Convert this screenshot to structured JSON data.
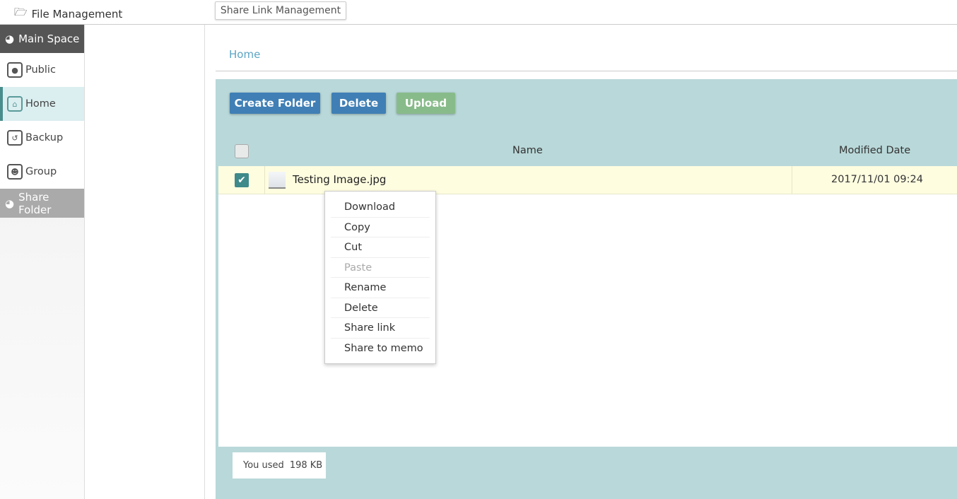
{
  "header": {
    "title": "File Management",
    "share_link_button": "Share Link Management"
  },
  "sidebar": {
    "main_space": "Main Space",
    "items": [
      {
        "label": "Public",
        "icon": "globe-icon"
      },
      {
        "label": "Home",
        "icon": "home-icon",
        "active": true
      },
      {
        "label": "Backup",
        "icon": "history-icon"
      },
      {
        "label": "Group",
        "icon": "group-icon"
      }
    ],
    "share_folder": "Share Folder"
  },
  "breadcrumb": {
    "home": "Home"
  },
  "toolbar": {
    "create_folder": "Create Folder",
    "delete": "Delete",
    "upload": "Upload"
  },
  "colors": {
    "primary_button": "#3f7fb5",
    "upload_button": "#88bb8a",
    "panel": "#b9d8d9",
    "selected_row": "#fefde0",
    "checkbox": "#3f8a8a"
  },
  "table": {
    "columns": [
      "Name",
      "Modified Date"
    ],
    "rows": [
      {
        "name": "Testing Image.jpg",
        "modified": "2017/11/01 09:24",
        "checked": true
      }
    ]
  },
  "context_menu": {
    "items": [
      {
        "label": "Download"
      },
      {
        "label": "Copy"
      },
      {
        "label": "Cut"
      },
      {
        "label": "Paste",
        "disabled": true
      },
      {
        "label": "Rename"
      },
      {
        "label": "Delete"
      },
      {
        "label": "Share link"
      },
      {
        "label": "Share to memo"
      }
    ]
  },
  "usage": {
    "label": "You used",
    "value": "198 KB"
  }
}
